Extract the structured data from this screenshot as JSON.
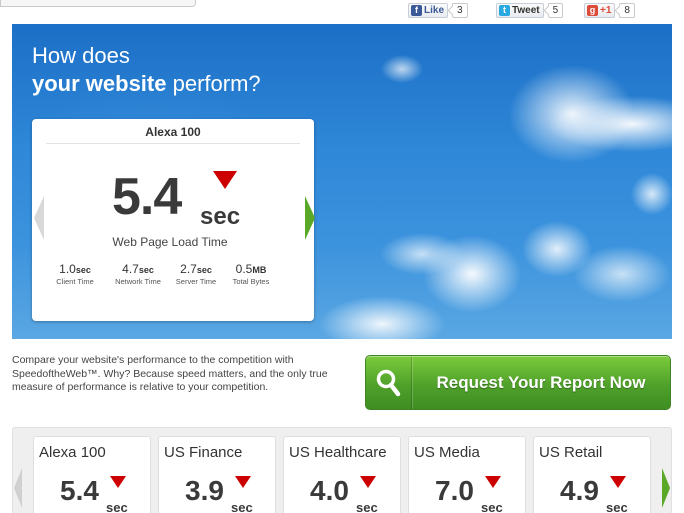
{
  "social": {
    "like_label": "Like",
    "like_count": "3",
    "tweet_label": "Tweet",
    "tweet_count": "5",
    "plusone_label": "+1",
    "plusone_count": "8"
  },
  "hero": {
    "title_line1": "How does",
    "title_bold": "your website",
    "title_rest": " perform?"
  },
  "card": {
    "title": "Alexa 100",
    "value": "5.4",
    "unit": "sec",
    "trend": "down-red-triangle",
    "label": "Web Page Load Time",
    "stats": [
      {
        "value": "1.0",
        "unit": "sec",
        "label": "Client Time"
      },
      {
        "value": "4.7",
        "unit": "sec",
        "label": "Network Time"
      },
      {
        "value": "2.7",
        "unit": "sec",
        "label": "Server Time"
      },
      {
        "value": "0.5",
        "unit": "MB",
        "label": "Total Bytes"
      }
    ]
  },
  "promo": {
    "description": "Compare your website's performance to the competition with SpeedoftheWeb™. Why? Because speed matters, and the only true measure of performance is relative to your competition.",
    "cta_label": "Request Your Report Now"
  },
  "carousel": [
    {
      "title": "Alexa 100",
      "value": "5.4",
      "unit": "sec"
    },
    {
      "title": "US Finance",
      "value": "3.9",
      "unit": "sec"
    },
    {
      "title": "US Healthcare",
      "value": "4.0",
      "unit": "sec"
    },
    {
      "title": "US Media",
      "value": "7.0",
      "unit": "sec"
    },
    {
      "title": "US Retail",
      "value": "4.9",
      "unit": "sec"
    }
  ],
  "colors": {
    "accent_green": "#4fa12a",
    "trend_red": "#cc0000",
    "sky_blue": "#2f88d8",
    "facebook_blue": "#3b5998",
    "twitter_blue": "#2aa9e0",
    "google_red": "#dd4b39"
  }
}
